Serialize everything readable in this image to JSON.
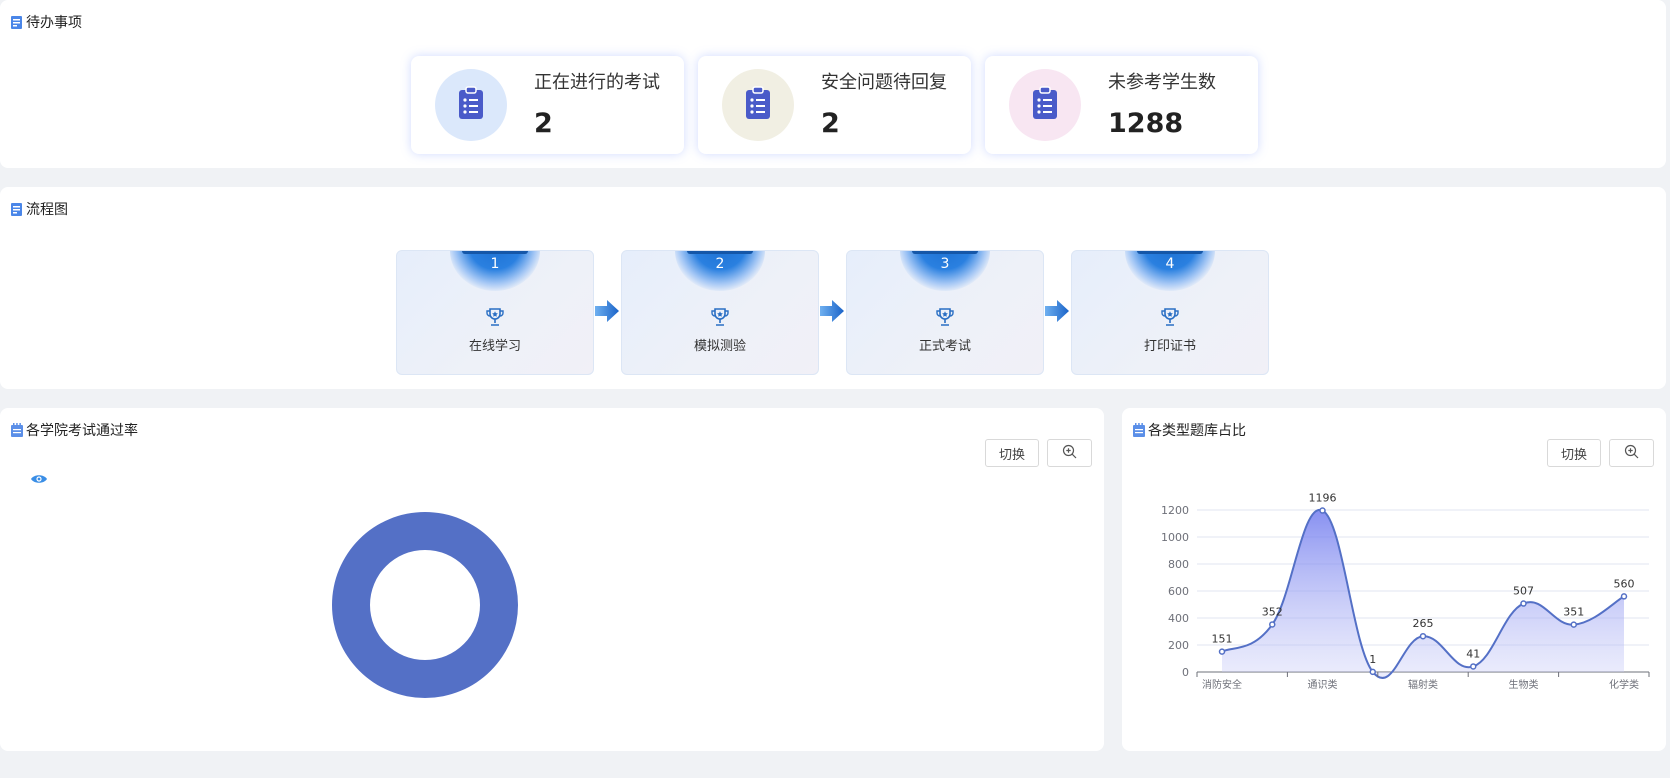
{
  "todo": {
    "title": "待办事项",
    "cards": [
      {
        "label": "正在进行的考试",
        "value": "2",
        "circle_color": "#dbe8fb"
      },
      {
        "label": "安全问题待回复",
        "value": "2",
        "circle_color": "#f1efe3"
      },
      {
        "label": "未参考学生数",
        "value": "1288",
        "circle_color": "#f8e6f2"
      }
    ],
    "icon": "clipboard-icon",
    "icon_color": "#4a5bc9"
  },
  "flow": {
    "title": "流程图",
    "steps": [
      {
        "num": "1",
        "label": "在线学习"
      },
      {
        "num": "2",
        "label": "模拟测验"
      },
      {
        "num": "3",
        "label": "正式考试"
      },
      {
        "num": "4",
        "label": "打印证书"
      }
    ],
    "step_icon": "trophy-icon",
    "connector_icon": "arrow-right-icon"
  },
  "pass_rate": {
    "title": "各学院考试通过率",
    "switch_label": "切换",
    "zoom_icon": "zoom-in-icon",
    "legend_icon": "eye-icon",
    "chart_data": {
      "type": "pie",
      "values": [
        100
      ],
      "colors": [
        "#5470c6"
      ]
    }
  },
  "bank_ratio": {
    "title": "各类型题库占比",
    "switch_label": "切换",
    "zoom_icon": "zoom-in-icon",
    "chart_data": {
      "type": "area",
      "x": [
        "消防安全",
        "",
        "通识类",
        "",
        "辐射类",
        "",
        "生物类",
        "",
        "化学类"
      ],
      "tick_labels": [
        "消防安全",
        "通识类",
        "辐射类",
        "生物类",
        "化学类"
      ],
      "values": [
        151,
        352,
        1196,
        1,
        265,
        41,
        507,
        351,
        560
      ],
      "ylim": [
        0,
        1200
      ],
      "yticks": [
        0,
        200,
        400,
        600,
        800,
        1000,
        1200
      ],
      "grid": true,
      "smooth": true,
      "line_color": "#5470c6"
    }
  }
}
